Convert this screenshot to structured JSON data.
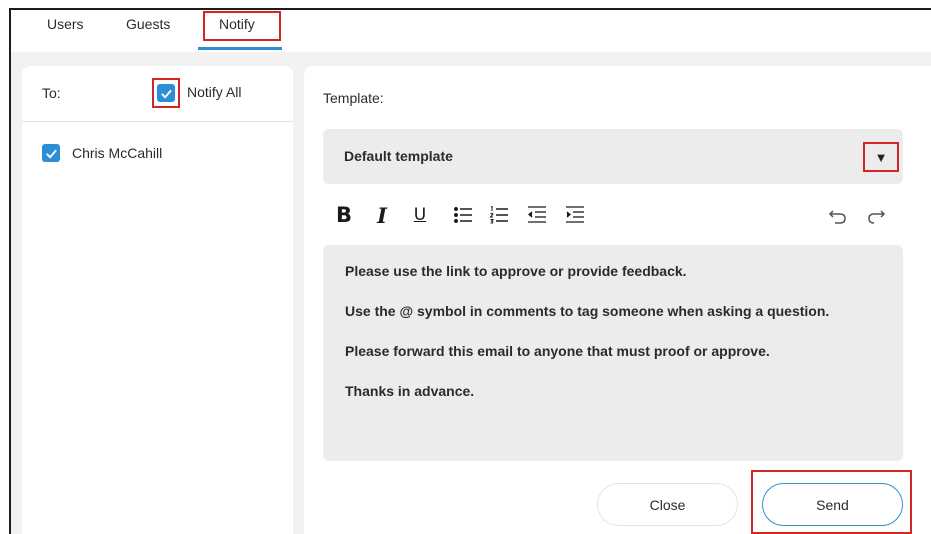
{
  "tabs": {
    "users": "Users",
    "guests": "Guests",
    "notify": "Notify",
    "active": "notify"
  },
  "recipients": {
    "to_label": "To:",
    "notify_all_label": "Notify All",
    "notify_all_checked": true,
    "items": [
      {
        "name": "Chris McCahill",
        "checked": true
      }
    ]
  },
  "template": {
    "label": "Template:",
    "selected": "Default template",
    "dropdown_icon": "triangle-down-icon"
  },
  "toolbar": {
    "bold": "B",
    "italic": "I",
    "underline": "U",
    "bullet_list_icon": "bullet-list-icon",
    "numbered_list_icon": "numbered-list-icon",
    "outdent_icon": "outdent-icon",
    "indent_icon": "indent-icon",
    "undo_icon": "undo-icon",
    "redo_icon": "redo-icon"
  },
  "message": {
    "paragraphs": [
      "Please use the link to approve or provide feedback.",
      "Use the @ symbol in comments to tag someone when asking a question.",
      "Please forward this email to anyone that must proof or approve.",
      "Thanks in advance."
    ]
  },
  "actions": {
    "close_label": "Close",
    "send_label": "Send"
  },
  "colors": {
    "accent": "#2a8fd6",
    "highlight": "#d42525",
    "panel_bg": "#f2f2f2",
    "field_bg": "#ececec"
  }
}
